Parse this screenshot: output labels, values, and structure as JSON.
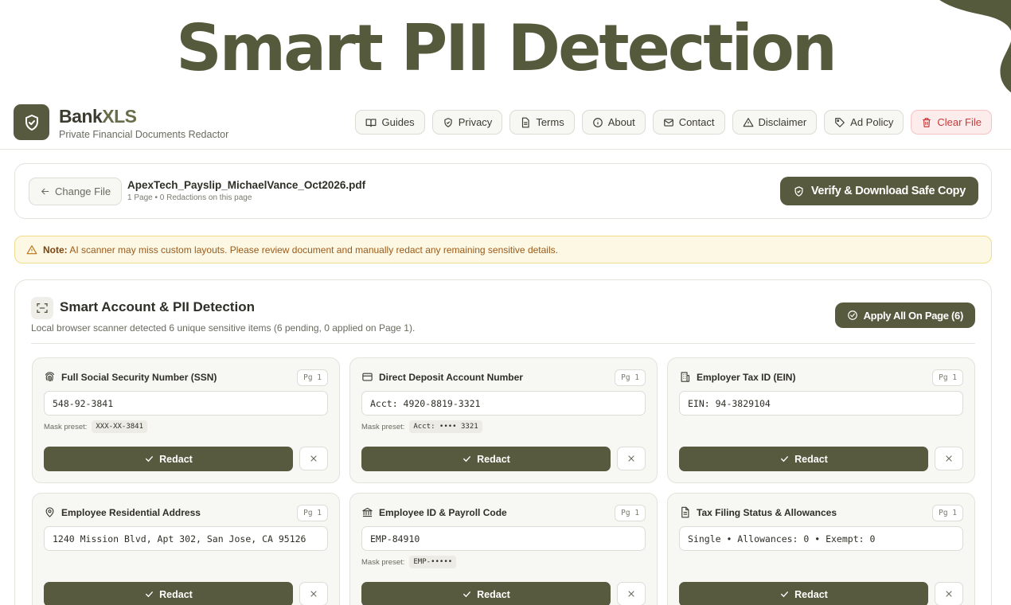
{
  "hero": {
    "title": "Smart PII Detection"
  },
  "app": {
    "brand_main": "Bank",
    "brand_accent": "XLS",
    "subtitle": "Private Financial Documents Redactor",
    "nav": [
      {
        "label": "Guides",
        "icon": "book-icon"
      },
      {
        "label": "Privacy",
        "icon": "shield-icon"
      },
      {
        "label": "Terms",
        "icon": "document-icon"
      },
      {
        "label": "About",
        "icon": "info-icon"
      },
      {
        "label": "Contact",
        "icon": "mail-icon"
      },
      {
        "label": "Disclaimer",
        "icon": "warning-icon"
      },
      {
        "label": "Ad Policy",
        "icon": "tag-icon"
      },
      {
        "label": "Clear File",
        "icon": "trash-icon"
      }
    ]
  },
  "file": {
    "change_label": "Change File",
    "name": "ApexTech_Payslip_MichaelVance_Oct2026.pdf",
    "meta": "1 Page • 0 Redactions on this page",
    "verify_label": "Verify & Download Safe Copy"
  },
  "note": {
    "prefix": "Note:",
    "text": "AI scanner may miss custom layouts. Please review document and manually redact any remaining sensitive details."
  },
  "detection": {
    "title": "Smart Account & PII Detection",
    "subtitle": "Local browser scanner detected 6 unique sensitive items (6 pending, 0 applied on Page 1).",
    "apply_label": "Apply All On Page (6)",
    "mask_label": "Mask preset:",
    "redact_label": "Redact",
    "items": [
      {
        "title": "Full Social Security Number (SSN)",
        "icon": "fingerprint-icon",
        "page": "Pg 1",
        "value": "548-92-3841",
        "mask": "XXX-XX-3841"
      },
      {
        "title": "Direct Deposit Account Number",
        "icon": "credit-card-icon",
        "page": "Pg 1",
        "value": "Acct: 4920-8819-3321",
        "mask": "Acct: •••• 3321"
      },
      {
        "title": "Employer Tax ID (EIN)",
        "icon": "building-icon",
        "page": "Pg 1",
        "value": "EIN: 94-3829104",
        "mask": ""
      },
      {
        "title": "Employee Residential Address",
        "icon": "map-pin-icon",
        "page": "Pg 1",
        "value": "1240 Mission Blvd, Apt 302, San Jose, CA 95126",
        "mask": ""
      },
      {
        "title": "Employee ID & Payroll Code",
        "icon": "bank-icon",
        "page": "Pg 1",
        "value": "EMP-84910",
        "mask": "EMP-•••••"
      },
      {
        "title": "Tax Filing Status & Allowances",
        "icon": "file-text-icon",
        "page": "Pg 1",
        "value": "Single • Allowances: 0 • Exempt: 0",
        "mask": ""
      }
    ]
  }
}
